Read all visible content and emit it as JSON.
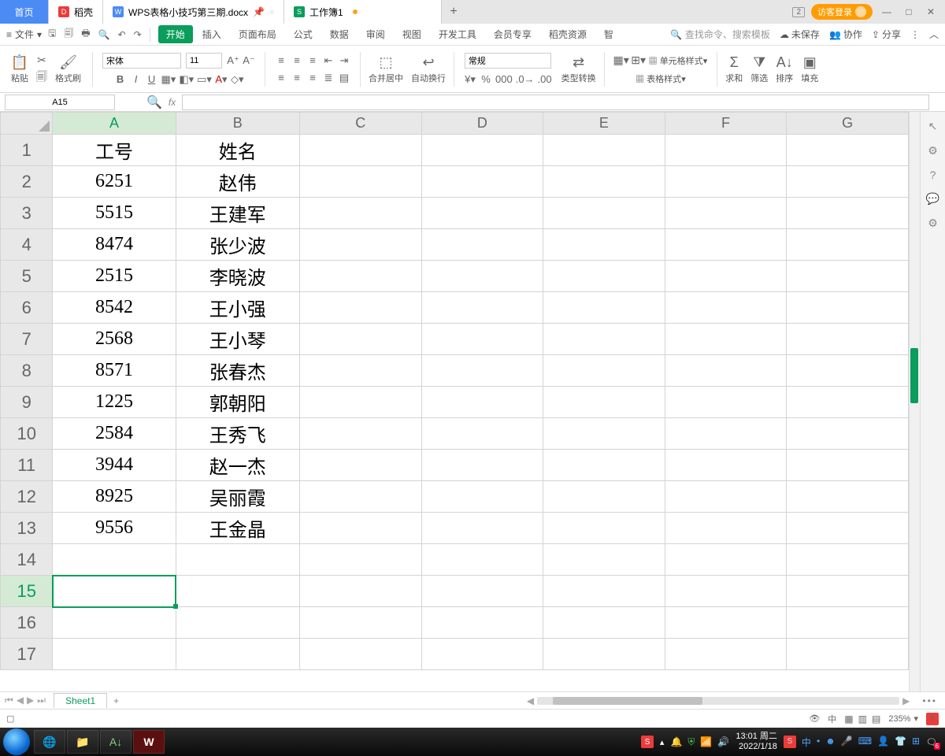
{
  "tabs": {
    "home": "首页",
    "docker": "稻壳",
    "doc": "WPS表格小技巧第三期.docx",
    "workbook": "工作簿1",
    "window_count": "2",
    "login": "访客登录"
  },
  "menu": {
    "file": "文件",
    "search_placeholder": "查找命令、搜索模板",
    "unsaved": "未保存",
    "collab": "协作",
    "share": "分享"
  },
  "ribbon_tabs": [
    "开始",
    "插入",
    "页面布局",
    "公式",
    "数据",
    "审阅",
    "视图",
    "开发工具",
    "会员专享",
    "稻壳资源",
    "智"
  ],
  "ribbon": {
    "paste": "粘贴",
    "format_painter": "格式刷",
    "font_name": "宋体",
    "font_size": "11",
    "merge": "合并居中",
    "wrap": "自动换行",
    "number_format": "常规",
    "type_convert": "类型转换",
    "cell_style": "单元格样式",
    "table_style": "表格样式",
    "sum": "求和",
    "filter": "筛选",
    "sort": "排序",
    "fill": "填充"
  },
  "namebox": "A15",
  "columns": [
    "A",
    "B",
    "C",
    "D",
    "E",
    "F",
    "G"
  ],
  "rows": [
    "1",
    "2",
    "3",
    "4",
    "5",
    "6",
    "7",
    "8",
    "9",
    "10",
    "11",
    "12",
    "13",
    "14",
    "15",
    "16",
    "17"
  ],
  "selected": {
    "row": 15,
    "col": 1
  },
  "cells": {
    "A1": "工号",
    "B1": "姓名",
    "A2": "6251",
    "B2": "赵伟",
    "A3": "5515",
    "B3": "王建军",
    "A4": "8474",
    "B4": "张少波",
    "A5": "2515",
    "B5": "李晓波",
    "A6": "8542",
    "B6": "王小强",
    "A7": "2568",
    "B7": "王小琴",
    "A8": "8571",
    "B8": "张春杰",
    "A9": "1225",
    "B9": "郭朝阳",
    "A10": "2584",
    "B10": "王秀飞",
    "A11": "3944",
    "B11": "赵一杰",
    "A12": "8925",
    "B12": "吴丽霞",
    "A13": "9556",
    "B13": "王金晶"
  },
  "sheet_tab": "Sheet1",
  "status": {
    "zoom": "235%",
    "lang": "中"
  },
  "taskbar": {
    "time": "13:01",
    "weekday": "周二",
    "date": "2022/1/18",
    "notif_count": "6",
    "ime": "中"
  }
}
